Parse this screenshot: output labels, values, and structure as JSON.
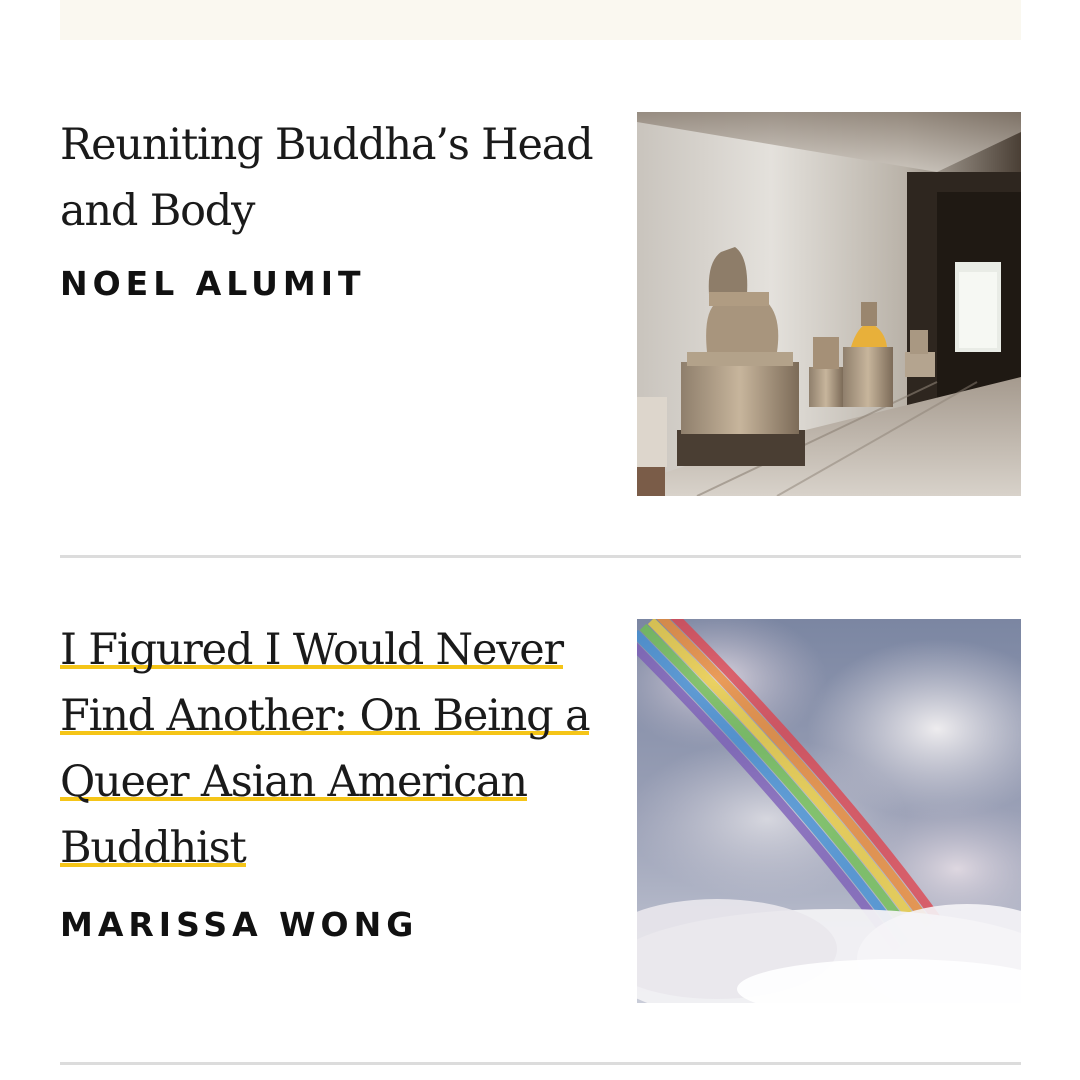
{
  "articles": [
    {
      "title": "Reuniting Buddha’s Head and Body",
      "author": "NOEL ALUMIT",
      "image_alt": "Headless Buddha statues along a stone temple corridor"
    },
    {
      "title": "I Figured I Would Never Find Another: On Being a Queer Asian American Buddhist",
      "author": "MARISSA WONG",
      "image_alt": "Rainbow arcing through grey clouds"
    }
  ],
  "colors": {
    "link_underline": "#f5c518",
    "divider": "#dcdcdc",
    "top_band": "#faf8f0"
  }
}
